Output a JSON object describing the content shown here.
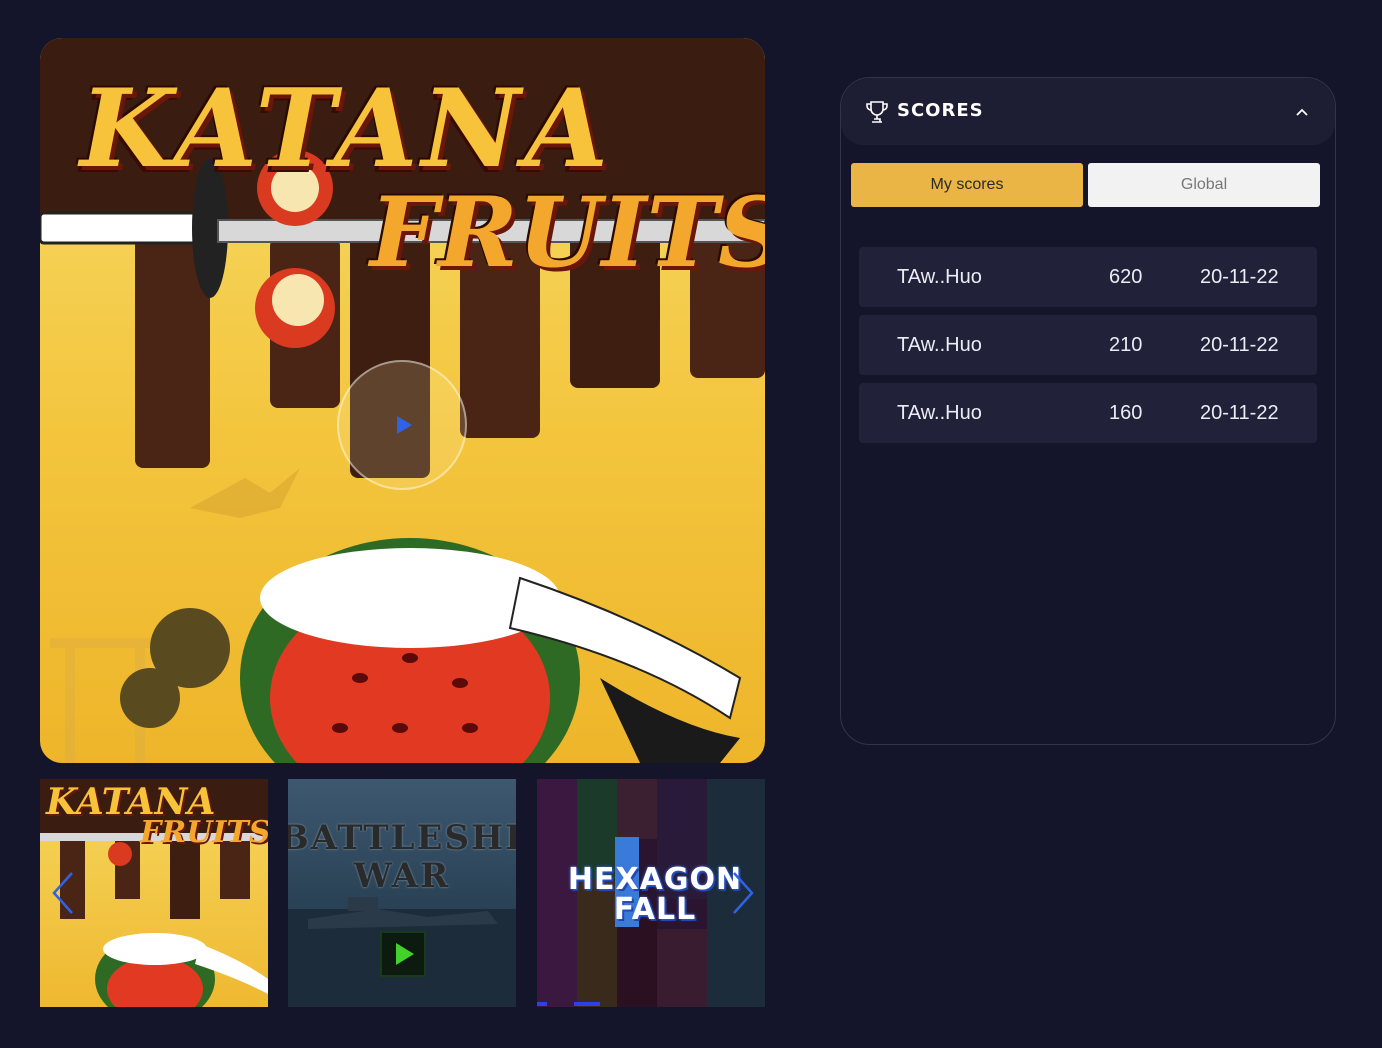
{
  "hero": {
    "title": "KATANA",
    "subtitle": "FRUITS",
    "play_icon": "play-icon"
  },
  "thumbnails": [
    {
      "title": "KATANA",
      "subtitle": "FRUITS"
    },
    {
      "title": "BATTLESHIP WAR",
      "icon": "play-icon"
    },
    {
      "title": "HEXAGON FALL"
    }
  ],
  "carousel": {
    "prev_icon": "chevron-left-icon",
    "next_icon": "chevron-right-icon"
  },
  "scores_panel": {
    "title": "SCORES",
    "title_icon": "trophy-icon",
    "collapse_icon": "chevron-up-icon",
    "tabs": [
      {
        "label": "My scores",
        "active": true
      },
      {
        "label": "Global",
        "active": false
      }
    ],
    "rows": [
      {
        "name": "TAw..Huo",
        "score": "620",
        "date": "20-11-22"
      },
      {
        "name": "TAw..Huo",
        "score": "210",
        "date": "20-11-22"
      },
      {
        "name": "TAw..Huo",
        "score": "160",
        "date": "20-11-22"
      }
    ]
  },
  "colors": {
    "background": "#14142a",
    "accent": "#ebb545",
    "row_bg": "#21213a",
    "play_blue": "#2f62e8"
  }
}
